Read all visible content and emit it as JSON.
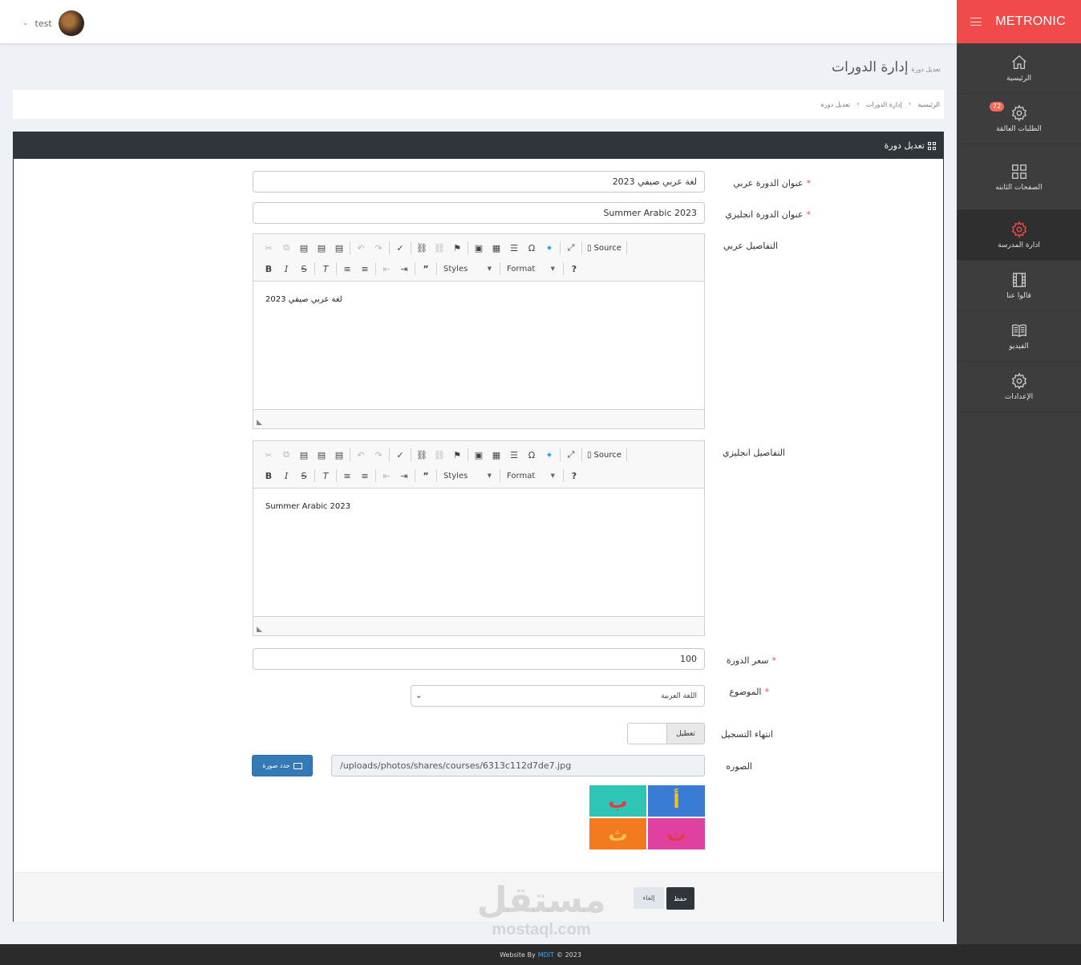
{
  "header": {
    "username": "test",
    "user_menu_chevron": "⌄"
  },
  "sidebar": {
    "brand": "METRONIC",
    "items": [
      {
        "label": "الرئيسية",
        "icon": "home-icon"
      },
      {
        "label": "الطلبات العالقة",
        "icon": "gear-icon",
        "badge": "72"
      },
      {
        "label": "الصفحات الثابته",
        "icon": "grid-icon"
      },
      {
        "label": "ادارة المدرسة",
        "icon": "gear-icon",
        "active": true
      },
      {
        "label": "قالوا عنا",
        "icon": "film-icon"
      },
      {
        "label": "الفيديو",
        "icon": "book-icon"
      },
      {
        "label": "الإعدادات",
        "icon": "gear-icon"
      }
    ]
  },
  "page": {
    "title": "إدارة الدورات",
    "subtitle": "تعديل دورة"
  },
  "breadcrumb": [
    "الرئيسية",
    "إدارة الدورات",
    "تعديل دورة"
  ],
  "portlet": {
    "title": "تعديل دورة"
  },
  "form": {
    "title_ar_label": "عنوان الدورة عربي",
    "title_ar_value": "لغة عربي صيفي 2023",
    "title_en_label": "عنوان الدورة انجليزي",
    "title_en_value": "Summer Arabic 2023",
    "details_ar_label": "التفاصيل عربي",
    "details_ar_value": "لغة عربي صيفي 2023",
    "details_en_label": "التفاصيل انجليزي",
    "details_en_value": "Summer Arabic 2023",
    "price_label": "سعر الدورة",
    "price_value": "100",
    "subject_label": "الموضوع",
    "subject_value": "اللغة العربية",
    "registration_end_label": "انتهاء التسجيل",
    "toggle_label": "تعطيل",
    "image_label": "الصوره",
    "choose_image_button": "حدد صورة",
    "image_path": "/uploads/photos/shares/courses/6313c112d7de7.jpg",
    "required_mark": "*"
  },
  "editor_toolbar": {
    "source_label": "Source",
    "styles_label": "Styles",
    "format_label": "Format",
    "help_label": "?"
  },
  "thumbnail_letters": [
    "أ",
    "ب",
    "ت",
    "ث"
  ],
  "actions": {
    "cancel_label": "إلغاء",
    "save_label": "حفظ"
  },
  "watermark": {
    "arabic": "مستقل",
    "latin": "mostaql.com"
  },
  "footer": {
    "prefix": "Website By",
    "link": "MDIT",
    "suffix": "© 2023"
  },
  "colors": {
    "brand_red": "#f04a4a",
    "sidebar_bg": "#3d3d3d",
    "portlet_head": "#2f353b",
    "primary_blue": "#337ab7"
  }
}
